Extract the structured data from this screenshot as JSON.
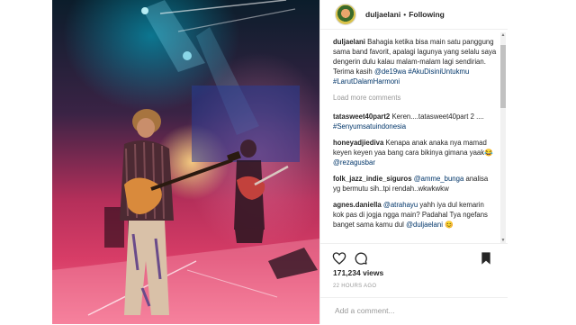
{
  "header": {
    "username": "duljaelani",
    "separator": "•",
    "follow_status": "Following"
  },
  "caption": {
    "username": "duljaelani",
    "text": "Bahagia ketika bisa main satu panggung sama band favorit, apalagi lagunya yang selalu saya dengerin dulu kalau malam-malam lagi sendirian. Terima kasih ",
    "mention": "@de19wa",
    "hashtags": "#AkuDisiniUntukmu #LarutDalamHarmoni"
  },
  "load_more": "Load more comments",
  "comments": [
    {
      "username": "tatasweet40part2",
      "text": "Keren....tatasweet40part 2 .... ",
      "tag": "#Senyumsatuindonesia"
    },
    {
      "username": "honeyadjiediva",
      "text": "Kenapa anak anaka nya mamad keyen keyen yaa bang cara bikinya gimana yaak😂 ",
      "tag": "@rezagusbar"
    },
    {
      "username": "folk_jazz_indie_siguros",
      "text": "",
      "tag": "@amme_bunga",
      "text2": " analisa yg bermutu sih..tpi rendah..wkwkwkw"
    },
    {
      "username": "agnes.daniella",
      "text": "",
      "tag": "@atrahayu",
      "text2": " yahh iya dul kemarin kok pas di jogja ngga main? Padahal Tya ngefans banget sama kamu dul ",
      "tag2": "@duljaelani",
      "text3": " 😊"
    }
  ],
  "likes": "171,234 views",
  "timestamp": "22 HOURS AGO",
  "add_comment": {
    "placeholder": "Add a comment..."
  },
  "icons": {
    "like": "heart-icon",
    "comment": "comment-icon",
    "save": "bookmark-icon"
  },
  "colors": {
    "link": "#003569",
    "muted": "#999999",
    "border": "#efefef"
  }
}
